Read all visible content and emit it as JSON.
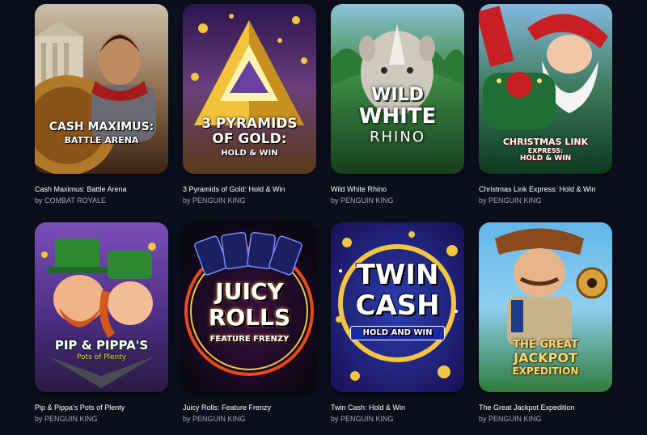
{
  "games": [
    {
      "title": "Cash Maximus: Battle Arena",
      "provider": "by COMBAT ROYALE",
      "logo": [
        "CASH MAXIMUS:",
        "BATTLE ARENA"
      ],
      "colors": {
        "bg_top": "#c8b9a4",
        "bg_bottom": "#4a2c1a",
        "accent": "#c48a2a"
      }
    },
    {
      "title": "3 Pyramids of Gold: Hold & Win",
      "provider": "by PENGUIN KING",
      "logo": [
        "3 PYRAMIDS",
        "OF GOLD:",
        "HOLD & WIN"
      ],
      "colors": {
        "bg_top": "#3a1d5e",
        "bg_bottom": "#7a5420",
        "accent": "#f4c542"
      }
    },
    {
      "title": "Wild White Rhino",
      "provider": "by PENGUIN KING",
      "logo": [
        "WILD",
        "WHITE",
        "RHINO"
      ],
      "colors": {
        "bg_top": "#3d8e4a",
        "bg_bottom": "#1e4d23",
        "accent": "#e8e1d6"
      }
    },
    {
      "title": "Christmas Link Express: Hold & Win",
      "provider": "by PENGUIN KING",
      "logo": [
        "CHRISTMAS LINK",
        "EXPRESS:",
        "HOLD & WIN"
      ],
      "colors": {
        "bg_top": "#7fb3df",
        "bg_bottom": "#0f4a26",
        "accent": "#c81e24"
      }
    },
    {
      "title": "Pip & Pippa's Pots of Plenty",
      "provider": "by PENGUIN KING",
      "logo": [
        "PIP & PIPPA'S",
        "Pots of Plenty"
      ],
      "colors": {
        "bg_top": "#6a3ea3",
        "bg_bottom": "#2f1950",
        "accent": "#2c9a3a"
      }
    },
    {
      "title": "Juicy Rolls: Feature Frenzy",
      "provider": "by PENGUIN KING",
      "logo": [
        "JUICY",
        "ROLLS",
        "FEATURE FRENZY"
      ],
      "colors": {
        "bg_top": "#1a0f2e",
        "bg_bottom": "#0c0716",
        "accent": "#f2b21a"
      }
    },
    {
      "title": "Twin Cash: Hold & Win",
      "provider": "by PENGUIN KING",
      "logo": [
        "TWIN",
        "CASH",
        "HOLD AND WIN"
      ],
      "colors": {
        "bg_top": "#1d2f8f",
        "bg_bottom": "#3a1c80",
        "accent": "#f4c542"
      }
    },
    {
      "title": "The Great Jackpot Expedition",
      "provider": "by PENGUIN KING",
      "logo": [
        "THE GREAT",
        "JACKPOT",
        "EXPEDITION"
      ],
      "colors": {
        "bg_top": "#5ab0e6",
        "bg_bottom": "#2f7a3a",
        "accent": "#f4c542"
      }
    }
  ]
}
